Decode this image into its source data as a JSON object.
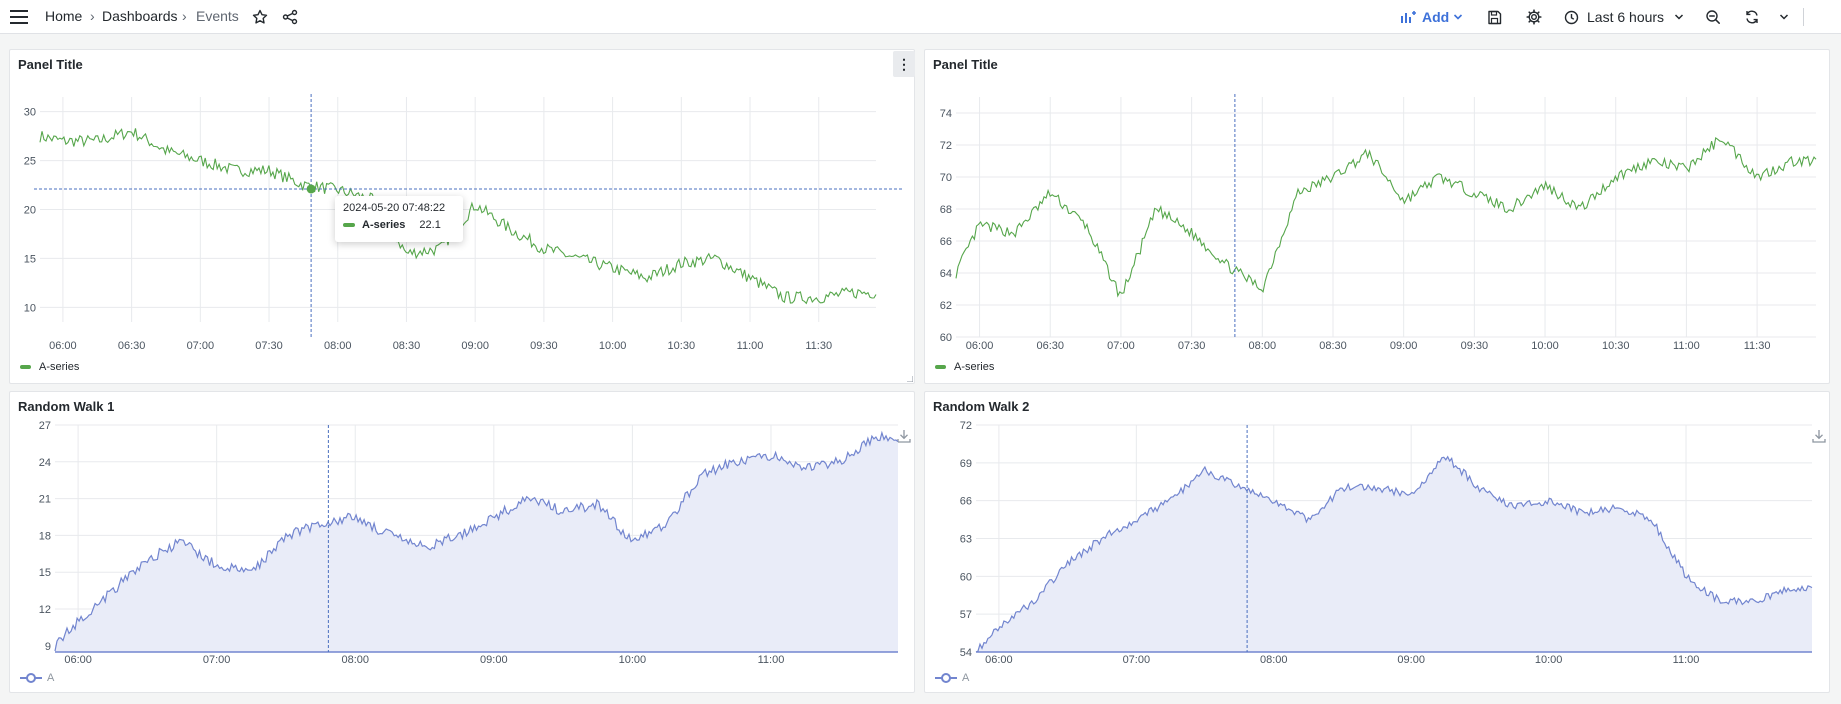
{
  "topbar": {
    "breadcrumb": [
      {
        "label": "Home"
      },
      {
        "label": "Dashboards"
      },
      {
        "label": "Events"
      }
    ],
    "separator": "›",
    "add_label": "Add",
    "time_range_label": "Last 6 hours"
  },
  "icons": [
    "hamburger-icon",
    "star-icon",
    "share-icon",
    "chart-add-icon",
    "chevron-down-icon",
    "save-icon",
    "gear-icon",
    "clock-icon",
    "zoom-out-icon",
    "refresh-icon",
    "download-icon",
    "kebab-menu-icon"
  ],
  "colors": {
    "green_series": "#56a64b",
    "blue_series": "#7285cf",
    "blue_fill": "#e9ecf8",
    "accent": "#3d71d9"
  },
  "panels": {
    "p1": {
      "title": "Panel Title",
      "legend": "A-series",
      "menu_icon": "⋮",
      "tooltip": {
        "time": "2024-05-20 07:48:22",
        "series": "A-series",
        "value": "22.1"
      }
    },
    "p2": {
      "title": "Panel Title",
      "legend": "A-series"
    },
    "p3": {
      "title": "Random Walk 1",
      "legend": "A"
    },
    "p4": {
      "title": "Random Walk 2",
      "legend": "A"
    }
  },
  "chart_data": [
    {
      "type": "line",
      "title": "Panel Title",
      "series": [
        {
          "name": "A-series",
          "x": [
            "05:50",
            "06:00",
            "06:15",
            "06:30",
            "06:45",
            "07:00",
            "07:15",
            "07:30",
            "07:45",
            "08:00",
            "08:15",
            "08:30",
            "08:45",
            "09:00",
            "09:15",
            "09:30",
            "09:45",
            "10:00",
            "10:15",
            "10:30",
            "10:45",
            "11:00",
            "11:15",
            "11:30",
            "11:45"
          ],
          "values": [
            27.5,
            27,
            27,
            28,
            26,
            25,
            24,
            24,
            22.5,
            22,
            21,
            15.5,
            16,
            20.5,
            18,
            16,
            15,
            14,
            13,
            14.5,
            15,
            13,
            11,
            11,
            11.5
          ]
        }
      ],
      "xticks": [
        "06:00",
        "06:30",
        "07:00",
        "07:30",
        "08:00",
        "08:30",
        "09:00",
        "09:30",
        "10:00",
        "10:30",
        "11:00",
        "11:30"
      ],
      "yticks": [
        10,
        15,
        20,
        25,
        30
      ],
      "ylim": [
        8.5,
        31.5
      ],
      "grid": true,
      "legend": "bottom-left",
      "crosshair": {
        "time": "07:48:22",
        "value": 22.1
      }
    },
    {
      "type": "line",
      "title": "Panel Title",
      "series": [
        {
          "name": "A-series",
          "x": [
            "05:50",
            "06:00",
            "06:15",
            "06:30",
            "06:45",
            "07:00",
            "07:15",
            "07:30",
            "07:45",
            "08:00",
            "08:15",
            "08:30",
            "08:45",
            "09:00",
            "09:15",
            "09:30",
            "09:45",
            "10:00",
            "10:15",
            "10:30",
            "10:45",
            "11:00",
            "11:15",
            "11:30",
            "11:45"
          ],
          "values": [
            64,
            67,
            66.5,
            69,
            67,
            62.5,
            68,
            66.5,
            64.5,
            63,
            69,
            70,
            71.5,
            68.5,
            70,
            69,
            68,
            69.5,
            68,
            70,
            71,
            70.5,
            72.5,
            70,
            71
          ]
        }
      ],
      "xticks": [
        "06:00",
        "06:30",
        "07:00",
        "07:30",
        "08:00",
        "08:30",
        "09:00",
        "09:30",
        "10:00",
        "10:30",
        "11:00",
        "11:30"
      ],
      "yticks": [
        60,
        62,
        64,
        66,
        68,
        70,
        72,
        74
      ],
      "ylim": [
        60,
        75
      ],
      "grid": true,
      "legend": "bottom-left"
    },
    {
      "type": "area",
      "title": "Random Walk 1",
      "series": [
        {
          "name": "A",
          "x": [
            "05:50",
            "06:00",
            "06:15",
            "06:30",
            "06:45",
            "07:00",
            "07:15",
            "07:30",
            "07:45",
            "08:00",
            "08:15",
            "08:30",
            "08:45",
            "09:00",
            "09:15",
            "09:30",
            "09:45",
            "10:00",
            "10:15",
            "10:30",
            "10:45",
            "11:00",
            "11:15",
            "11:30",
            "11:45"
          ],
          "values": [
            9,
            11,
            13.5,
            16,
            17.5,
            15.5,
            15,
            18,
            19,
            19.5,
            18,
            17,
            18,
            19.5,
            21,
            20,
            20.5,
            17.5,
            19,
            23,
            24,
            24.5,
            23.5,
            24,
            26
          ]
        }
      ],
      "xticks": [
        "06:00",
        "07:00",
        "08:00",
        "09:00",
        "10:00",
        "11:00"
      ],
      "yticks": [
        9,
        12,
        15,
        18,
        21,
        24,
        27
      ],
      "ylim": [
        8.5,
        27
      ],
      "grid": true,
      "legend": "bottom-left"
    },
    {
      "type": "area",
      "title": "Random Walk 2",
      "series": [
        {
          "name": "A",
          "x": [
            "05:50",
            "06:00",
            "06:15",
            "06:30",
            "06:45",
            "07:00",
            "07:15",
            "07:30",
            "07:45",
            "08:00",
            "08:15",
            "08:30",
            "08:45",
            "09:00",
            "09:15",
            "09:30",
            "09:45",
            "10:00",
            "10:15",
            "10:30",
            "10:45",
            "11:00",
            "11:15",
            "11:30",
            "11:45"
          ],
          "values": [
            54,
            56,
            58,
            61,
            63,
            64.5,
            66,
            68.5,
            67,
            66,
            64.5,
            67,
            67,
            66.5,
            69.5,
            67,
            65.5,
            66,
            65,
            65.5,
            64.5,
            60,
            58,
            58,
            59
          ]
        }
      ],
      "xticks": [
        "06:00",
        "07:00",
        "08:00",
        "09:00",
        "10:00",
        "11:00"
      ],
      "yticks": [
        54,
        57,
        60,
        63,
        66,
        69,
        72
      ],
      "ylim": [
        54,
        72
      ],
      "grid": true,
      "legend": "bottom-left"
    }
  ]
}
